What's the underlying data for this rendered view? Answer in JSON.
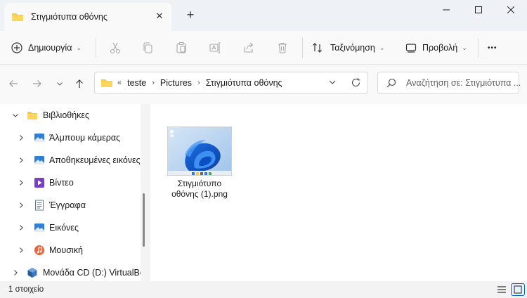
{
  "window": {
    "tab_title": "Στιγμιότυπα οθόνης",
    "tab_close": "✕",
    "new_tab": "+"
  },
  "toolbar": {
    "new_label": "Δημιουργία",
    "sort_label": "Ταξινόμηση",
    "view_label": "Προβολή",
    "more_label": "•••"
  },
  "address": {
    "overflow": "«",
    "crumbs": [
      "teste",
      "Pictures",
      "Στιγμιότυπα οθόνης"
    ],
    "separator": "›"
  },
  "search": {
    "placeholder": "Αναζήτηση σε: Στιγμιότυπα ..."
  },
  "sidebar": {
    "items": [
      {
        "label": "Βιβλιοθήκες",
        "icon": "library-folder-icon"
      },
      {
        "label": "Άλμπουμ κάμερας",
        "icon": "pictures-icon"
      },
      {
        "label": "Αποθηκευμένες εικόνες",
        "icon": "pictures-icon"
      },
      {
        "label": "Βίντεο",
        "icon": "videos-icon"
      },
      {
        "label": "Έγγραφα",
        "icon": "documents-icon"
      },
      {
        "label": "Εικόνες",
        "icon": "pictures-icon"
      },
      {
        "label": "Μουσική",
        "icon": "music-icon"
      },
      {
        "label": "Μονάδα CD (D:) VirtualBo",
        "icon": "cd-drive-icon"
      }
    ]
  },
  "files": [
    {
      "name_line1": "Στιγμιότυπο",
      "name_line2": "οθόνης (1).png"
    }
  ],
  "status": {
    "count": "1 στοιχείο"
  },
  "colors": {
    "folder_yellow": "#f8c945",
    "accent_blue": "#0067c0"
  }
}
